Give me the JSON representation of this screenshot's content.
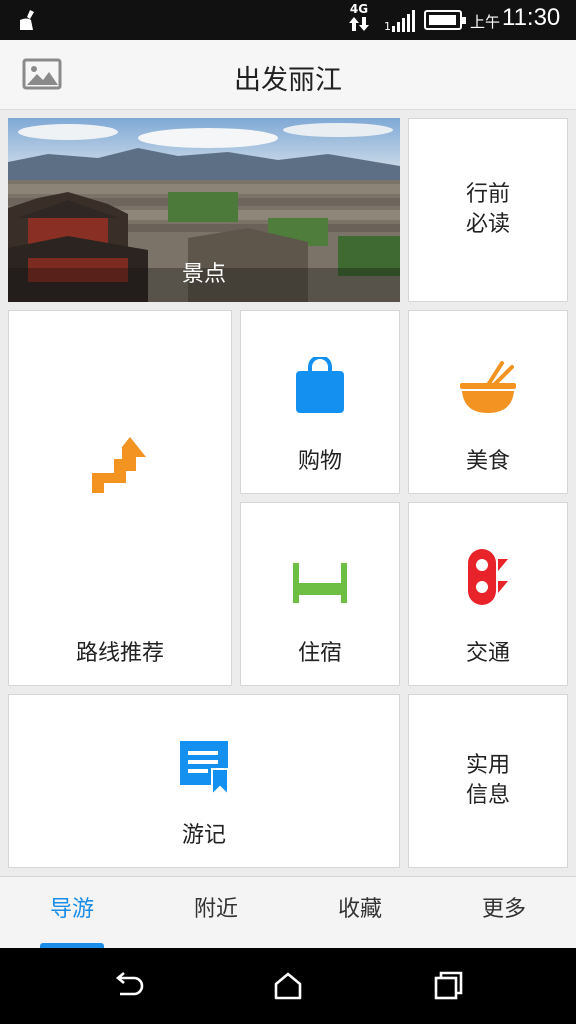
{
  "status_bar": {
    "network": "4G",
    "signal_num": "1",
    "am_pm": "上午",
    "time": "11:30",
    "battery_level": 0.95,
    "icons": [
      "broom-icon",
      "network-arrows-icon",
      "signal-icon",
      "battery-icon"
    ]
  },
  "header": {
    "title": "出发丽江",
    "left_icon": "image-icon"
  },
  "tiles": {
    "scenic": "景点",
    "before_trip": "行前\n必读",
    "route": "路线推荐",
    "shopping": "购物",
    "food": "美食",
    "lodging": "住宿",
    "transport": "交通",
    "travelogue": "游记",
    "practical": "实用\n信息"
  },
  "tabs": [
    {
      "label": "导游",
      "active": true
    },
    {
      "label": "附近",
      "active": false
    },
    {
      "label": "收藏",
      "active": false
    },
    {
      "label": "更多",
      "active": false
    }
  ],
  "colors": {
    "accent": "#1a8de9",
    "route_orange": "#f39321",
    "shopping_blue": "#1390f0",
    "food_orange": "#f39321",
    "lodging_green": "#6fbe44",
    "transport_red": "#e8232a",
    "travelogue_blue": "#1390f0"
  }
}
